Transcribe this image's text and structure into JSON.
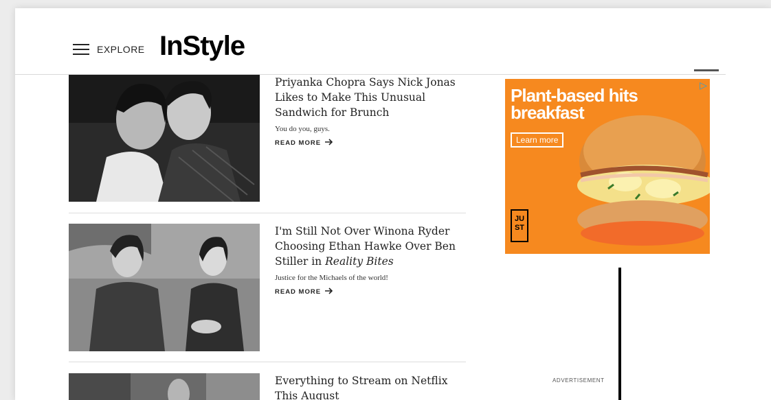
{
  "header": {
    "explore_label": "EXPLORE",
    "logo": "InStyle"
  },
  "articles": [
    {
      "title": "Priyanka Chopra Says Nick Jonas Likes to Make This Unusual Sandwich for Brunch",
      "dek": "You do you, guys.",
      "read_more": "READ MORE"
    },
    {
      "title_prefix": "I'm Still Not Over Winona Ryder Choosing Ethan Hawke Over Ben Stiller in ",
      "title_italic": "Reality Bites",
      "dek": "Justice for the Michaels of the world!",
      "read_more": "READ MORE"
    },
    {
      "title": "Everything to Stream on Netflix This August"
    }
  ],
  "ad": {
    "headline_line1": "Plant-based hits",
    "headline_line2": "breakfast",
    "cta": "Learn more",
    "brand_logo": "JU ST",
    "label": "ADVERTISEMENT",
    "colors": {
      "background": "#f6891f",
      "text": "#ffffff"
    }
  }
}
